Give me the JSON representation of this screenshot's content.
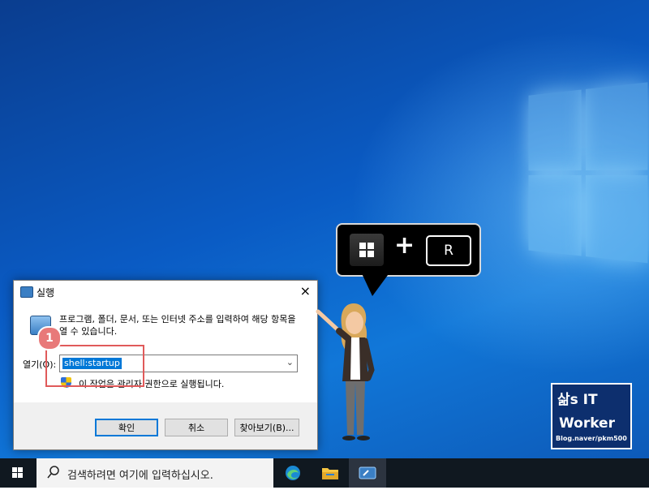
{
  "shortcut": {
    "key_name": "R"
  },
  "run_dialog": {
    "title": "실행",
    "close_glyph": "×",
    "description": "프로그램, 폴더, 문서, 또는 인터넷 주소를 입력하여 해당 항목을 열 수 있습니다.",
    "open_label": "열기(O):",
    "open_value": "shell:startup",
    "dropdown_glyph": "⌄",
    "admin_note": "이 작업은 관리자 권한으로 실행됩니다.",
    "ok_label": "확인",
    "cancel_label": "취소",
    "browse_label": "찾아보기(B)..."
  },
  "annotation": {
    "step_number": "1",
    "highlight_color": "#e05a5a"
  },
  "watermark": {
    "line1": "삶s IT",
    "line2": "Worker",
    "line3": "Blog.naver/pkm500"
  },
  "taskbar": {
    "search_placeholder": "검색하려면 여기에 입력하십시오.",
    "icons": [
      "windows-start-icon",
      "edge-icon",
      "file-explorer-icon",
      "run-app-icon"
    ]
  }
}
